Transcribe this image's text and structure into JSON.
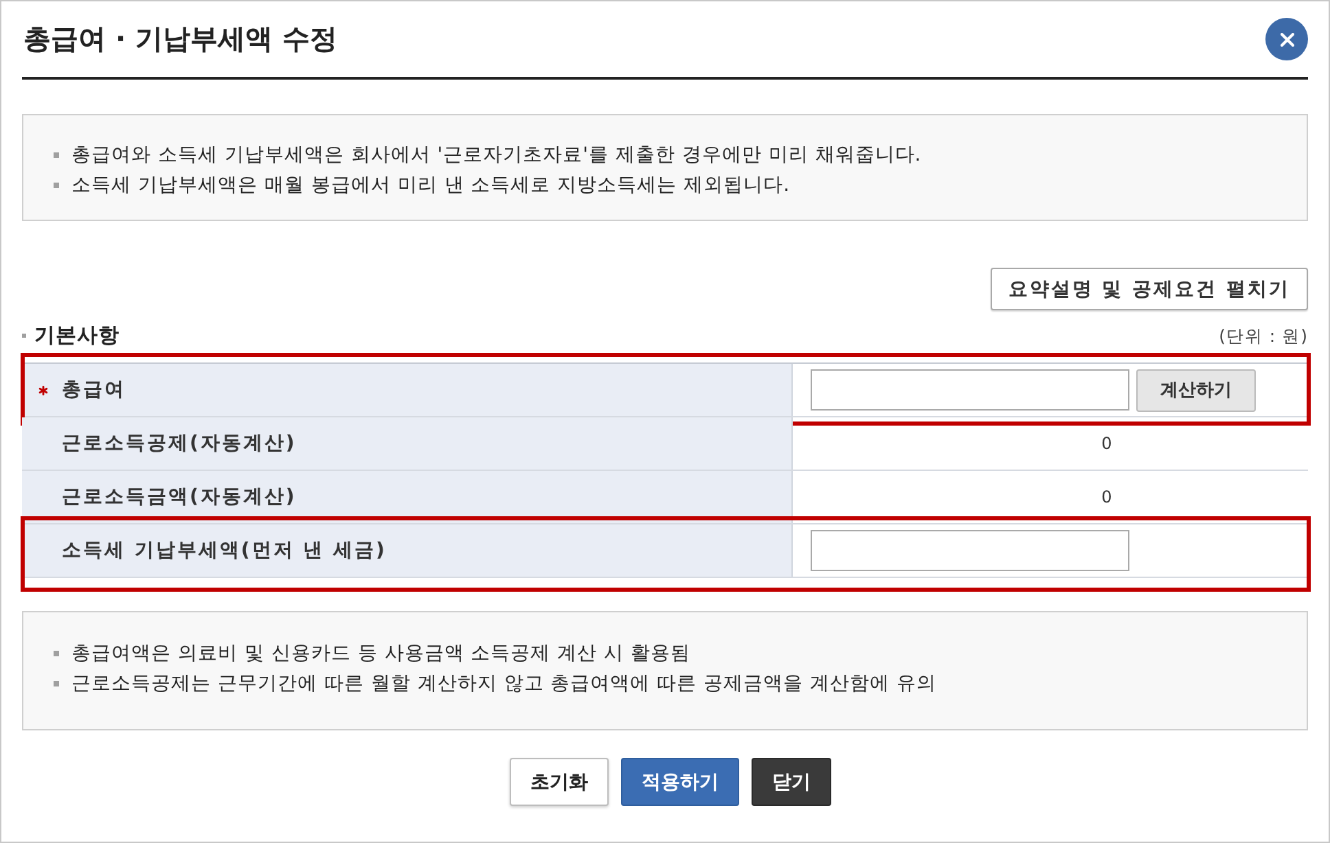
{
  "dialog": {
    "title": "총급여 · 기납부세액 수정"
  },
  "notice_top": {
    "items": [
      "총급여와 소득세 기납부세액은 회사에서 '근로자기초자료'를 제출한 경우에만 미리 채워줍니다.",
      "소득세 기납부세액은 매월 봉급에서 미리 낸 소득세로 지방소득세는 제외됩니다."
    ]
  },
  "expand_button": "요약설명 및 공제요건 펼치기",
  "basics": {
    "title": "기본사항",
    "unit": "(단위 : 원)",
    "rows": [
      {
        "kind": "input_button",
        "label": "총급여",
        "required": true,
        "highlighted": true,
        "button": "계산하기"
      },
      {
        "kind": "value",
        "label": "근로소득공제(자동계산)",
        "required": false,
        "highlighted": false,
        "value": "0"
      },
      {
        "kind": "value",
        "label": "근로소득금액(자동계산)",
        "required": false,
        "highlighted": false,
        "value": "0"
      },
      {
        "kind": "input",
        "label": "소득세 기납부세액(먼저 낸 세금)",
        "required": false,
        "highlighted": true
      }
    ]
  },
  "notice_bottom": {
    "items": [
      "총급여액은 의료비 및 신용카드 등 사용금액 소득공제 계산 시 활용됨",
      "근로소득공제는 근무기간에 따른 월할 계산하지 않고 총급여액에 따른 공제금액을 계산함에 유의"
    ]
  },
  "buttons": [
    {
      "kind": "reset",
      "label": "초기화"
    },
    {
      "kind": "primary",
      "label": "적용하기"
    },
    {
      "kind": "dark",
      "label": "닫기"
    }
  ]
}
